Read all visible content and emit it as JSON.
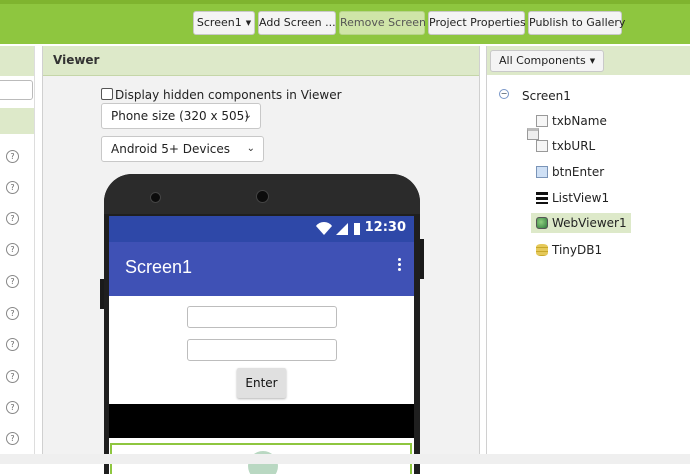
{
  "toolbar": {
    "screen_select": "Screen1",
    "add_screen": "Add Screen ...",
    "remove_screen": "Remove Screen",
    "project_properties": "Project Properties",
    "publish": "Publish to Gallery"
  },
  "palette": {
    "help_icon_glyph": "?"
  },
  "viewer": {
    "title": "Viewer",
    "hidden_checkbox_label": "Display hidden components in Viewer",
    "phone_size": "Phone size (320 x 505)",
    "device_type": "Android 5+ Devices",
    "chevron_glyph": "⌄",
    "phone": {
      "status_time": "12:30",
      "app_title": "Screen1",
      "enter_button": "Enter"
    }
  },
  "components": {
    "filter": "All Components",
    "collapse_glyph": "−",
    "tree": [
      {
        "label": "Screen1",
        "icon": "screen-icon"
      },
      {
        "label": "txbName",
        "icon": "textbox-icon"
      },
      {
        "label": "txbURL",
        "icon": "textbox-icon"
      },
      {
        "label": "btnEnter",
        "icon": "button-icon"
      },
      {
        "label": "ListView1",
        "icon": "listview-icon"
      },
      {
        "label": "WebViewer1",
        "icon": "webviewer-icon",
        "selected": true
      },
      {
        "label": "TinyDB1",
        "icon": "database-icon"
      }
    ]
  },
  "colors": {
    "topbar": "#8ec63f",
    "panel_header": "#dde9c9",
    "app_bar": "#3f51b5",
    "status_bar": "#2e48a8"
  }
}
